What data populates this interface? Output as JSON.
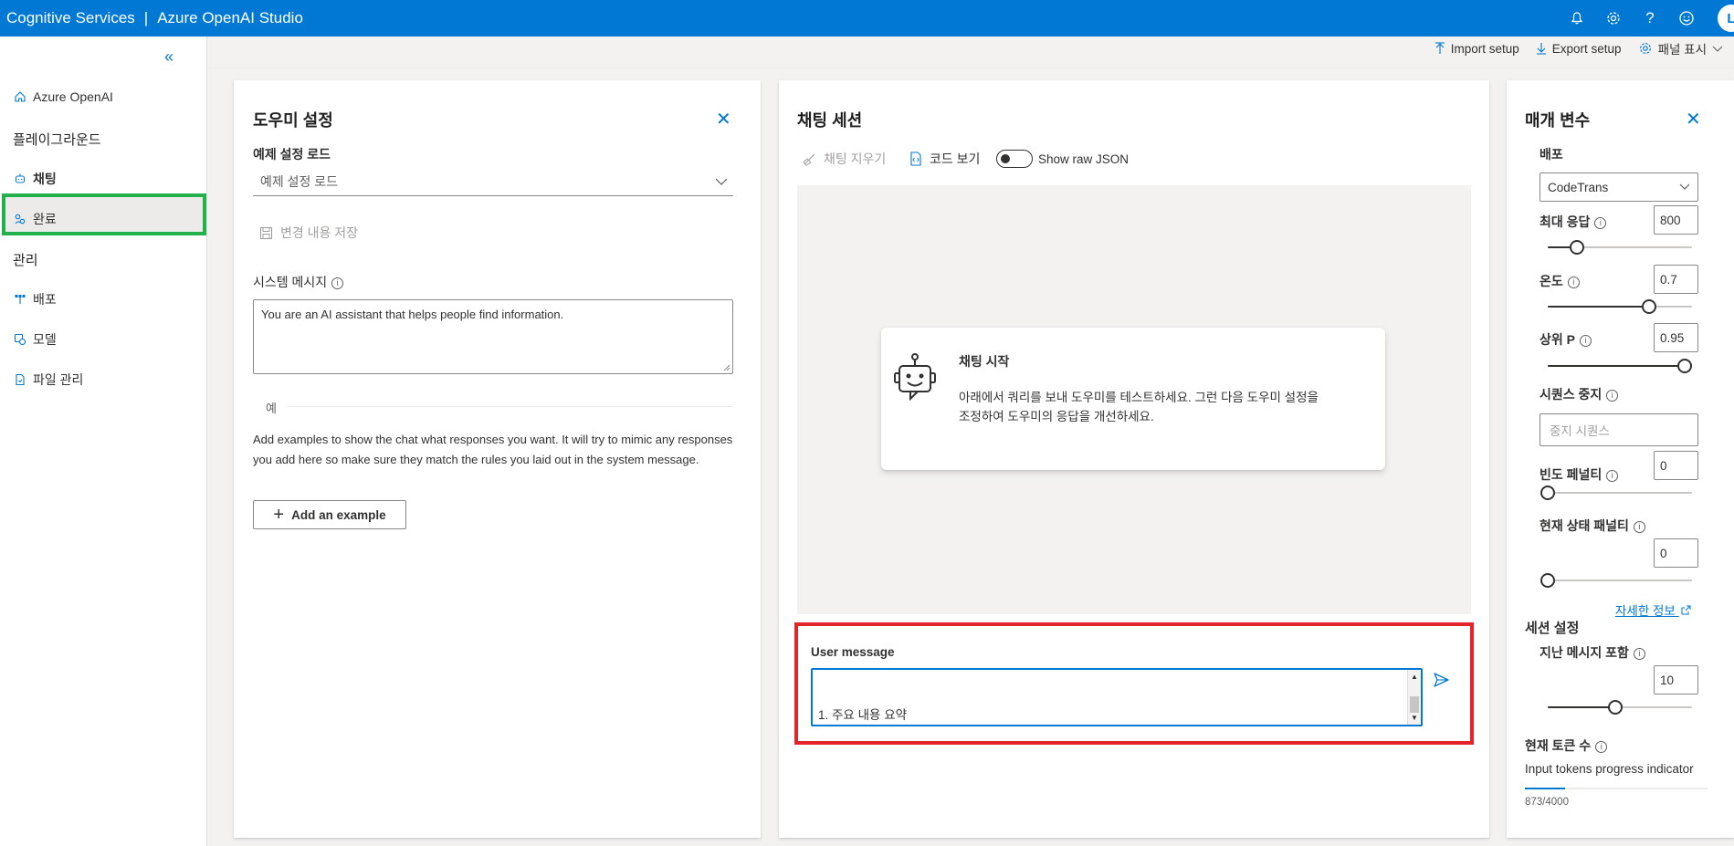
{
  "header": {
    "service": "Cognitive Services",
    "separator": "|",
    "product": "Azure OpenAI Studio",
    "avatar_initial": "L",
    "accent": "#0078d4"
  },
  "nav": {
    "collapse_glyph": "«",
    "home": "Azure OpenAI",
    "playground_heading": "플레이그라운드",
    "chat": "채팅",
    "completions": "완료",
    "management_heading": "관리",
    "deployments": "배포",
    "models": "모델",
    "file_management": "파일 관리"
  },
  "toolbar": {
    "import": "Import setup",
    "export": "Export setup",
    "show_panels": "패널 표시"
  },
  "assistant": {
    "title": "도우미 설정",
    "load_example_label": "예제 설정 로드",
    "load_example_placeholder": "예제 설정 로드",
    "save_changes": "변경 내용 저장",
    "system_message_label": "시스템 메시지",
    "system_message": "You are an AI assistant that helps people find information.",
    "examples_heading": "예",
    "examples_description": "Add examples to show the chat what responses you want. It will try to mimic any responses you add here so make sure they match the rules you laid out in the system message.",
    "add_example": "Add an example"
  },
  "chat": {
    "title": "채팅 세션",
    "clear_chat": "채팅 지우기",
    "view_code": "코드 보기",
    "show_raw_json": "Show raw JSON",
    "start_title": "채팅 시작",
    "start_desc_line1": "아래에서 쿼리를 보내 도우미를 테스트하세요. 그런 다음 도우미 설정을",
    "start_desc_line2": "조정하여 도우미의 응답을 개선하세요.",
    "user_message_label": "User message",
    "user_message_lines": [
      "1. 주요 내용 요약"
    ]
  },
  "params": {
    "title": "매개 변수",
    "deployment_label": "배포",
    "deployment_value": "CodeTrans",
    "max_response_label": "최대 응답",
    "max_response": "800",
    "max_response_fraction": 0.2,
    "temperature_label": "온도",
    "temperature": "0.7",
    "temperature_fraction": 0.7,
    "top_p_label": "상위 P",
    "top_p": "0.95",
    "top_p_fraction": 0.95,
    "stop_sequence_label": "시퀀스 중지",
    "stop_sequence_placeholder": "중지 시퀀스",
    "frequency_penalty_label": "빈도 페널티",
    "frequency_penalty": "0",
    "frequency_fraction": 0,
    "presence_penalty_label": "현재 상태 패널티",
    "presence_penalty": "0",
    "presence_fraction": 0,
    "learn_more": "자세한 정보",
    "session_heading": "세션 설정",
    "past_messages_label": "지난 메시지 포함",
    "past_messages": "10",
    "past_messages_fraction": 0.47,
    "token_count_label": "현재 토큰 수",
    "token_progress_label": "Input tokens progress indicator",
    "token_count": "873/4000",
    "token_fraction": 0.218
  }
}
